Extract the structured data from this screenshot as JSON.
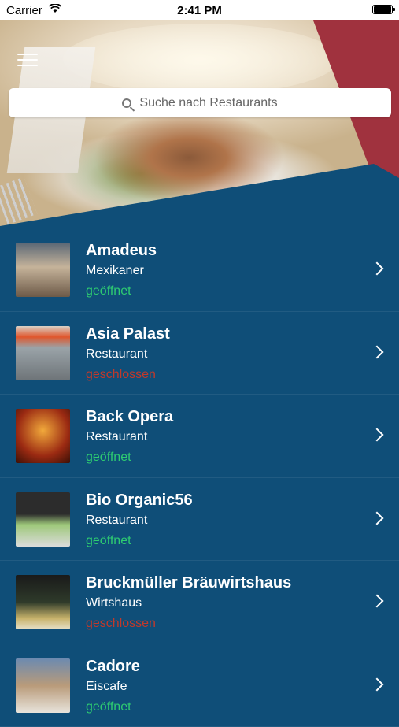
{
  "statusbar": {
    "carrier": "Carrier",
    "time": "2:41 PM"
  },
  "search": {
    "placeholder": "Suche nach Restaurants"
  },
  "restaurants": [
    {
      "name": "Amadeus",
      "category": "Mexikaner",
      "status": "geöffnet",
      "open": true
    },
    {
      "name": "Asia Palast",
      "category": "Restaurant",
      "status": "geschlossen",
      "open": false
    },
    {
      "name": "Back Opera",
      "category": "Restaurant",
      "status": "geöffnet",
      "open": true
    },
    {
      "name": "Bio Organic56",
      "category": "Restaurant",
      "status": "geöffnet",
      "open": true
    },
    {
      "name": "Bruckmüller Bräuwirtshaus",
      "category": "Wirtshaus",
      "status": "geschlossen",
      "open": false
    },
    {
      "name": "Cadore",
      "category": "Eiscafe",
      "status": "geöffnet",
      "open": true
    }
  ],
  "colors": {
    "background": "#0f4e78",
    "accent_red": "#a0323e",
    "open": "#2ecc71",
    "closed": "#c0392b"
  }
}
